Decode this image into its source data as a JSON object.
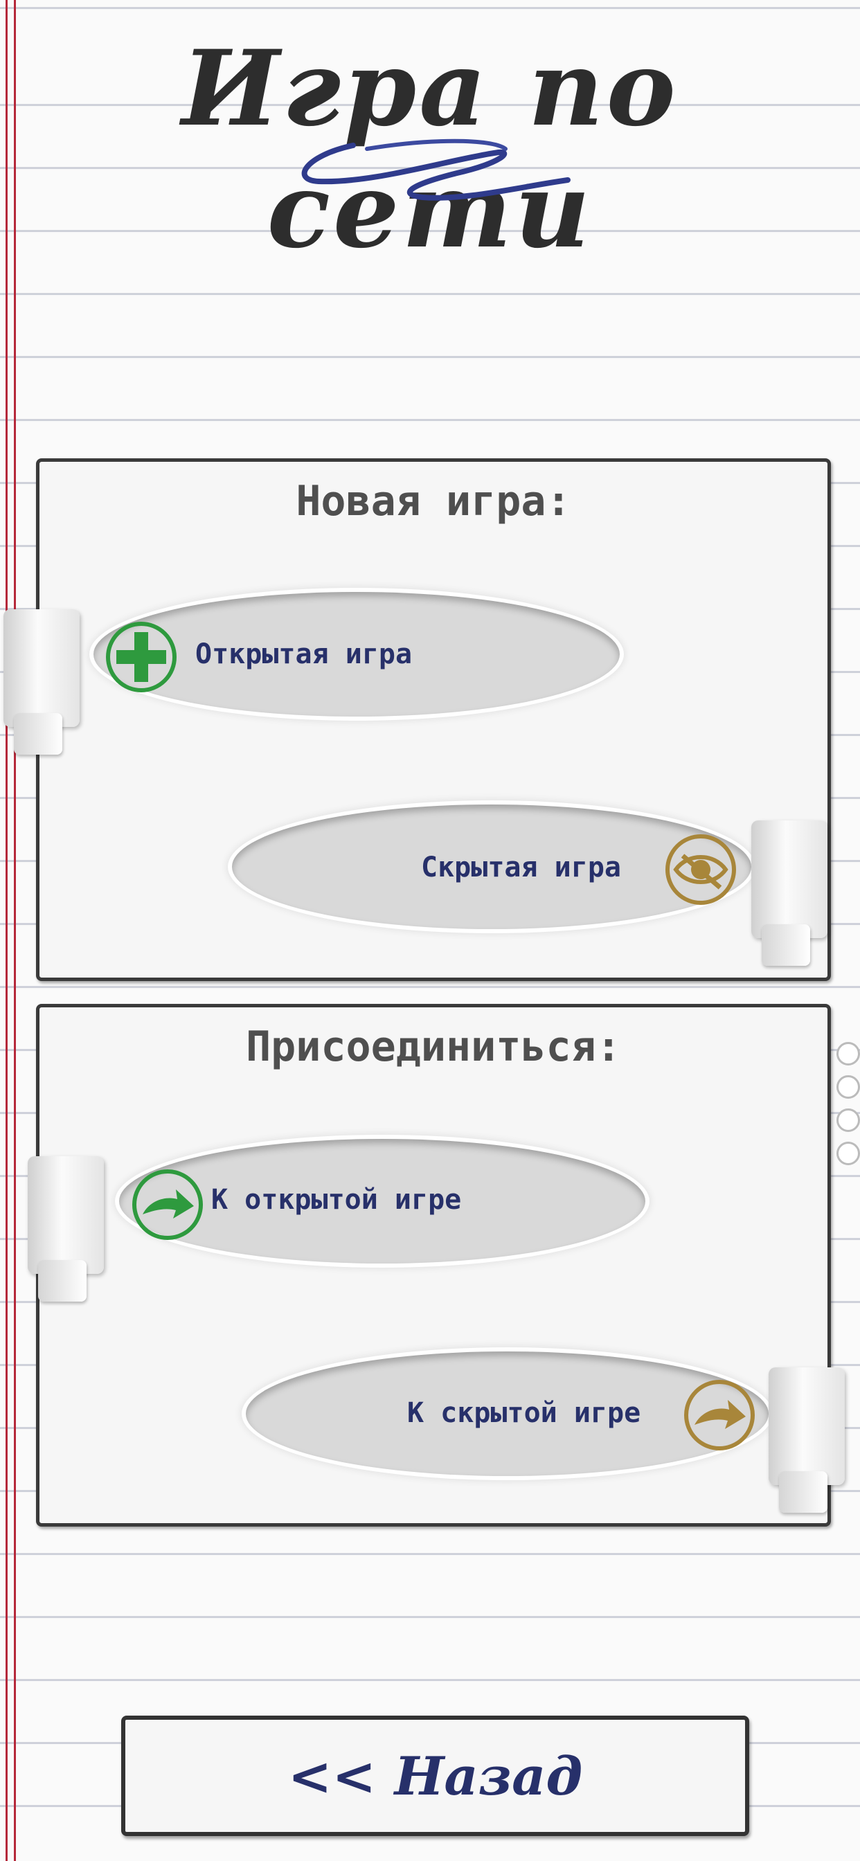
{
  "title": "Игра по сети",
  "new_game": {
    "heading": "Новая игра:",
    "open": {
      "label": "Открытая игра",
      "icon": "plus-icon",
      "color": "#2e9a3e"
    },
    "hidden": {
      "label": "Скрытая игра",
      "icon": "eye-crossed-icon",
      "color": "#a8863a"
    }
  },
  "join": {
    "heading": "Присоединиться:",
    "open": {
      "label": "К открытой игре",
      "icon": "arrow-right-icon",
      "color": "#2e9a3e"
    },
    "hidden": {
      "label": "К скрытой игре",
      "icon": "arrow-right-icon",
      "color": "#a8863a"
    }
  },
  "back_button": {
    "label": "<< Назад"
  },
  "colors": {
    "ink": "#27306a",
    "margin_line": "#b5283a",
    "rule_line": "#c9ccd6"
  }
}
